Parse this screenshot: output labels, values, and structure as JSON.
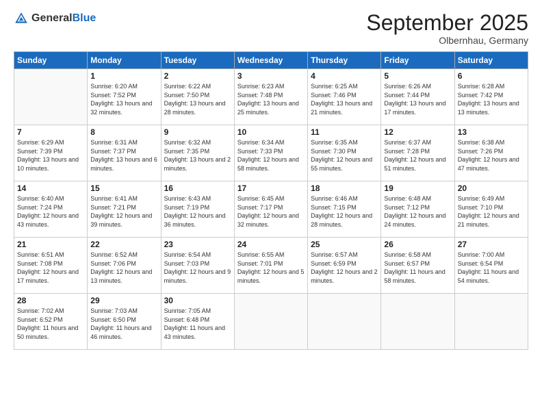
{
  "header": {
    "logo_general": "General",
    "logo_blue": "Blue",
    "month_title": "September 2025",
    "subtitle": "Olbernhau, Germany"
  },
  "weekdays": [
    "Sunday",
    "Monday",
    "Tuesday",
    "Wednesday",
    "Thursday",
    "Friday",
    "Saturday"
  ],
  "weeks": [
    [
      {
        "day": "",
        "sunrise": "",
        "sunset": "",
        "daylight": ""
      },
      {
        "day": "1",
        "sunrise": "Sunrise: 6:20 AM",
        "sunset": "Sunset: 7:52 PM",
        "daylight": "Daylight: 13 hours and 32 minutes."
      },
      {
        "day": "2",
        "sunrise": "Sunrise: 6:22 AM",
        "sunset": "Sunset: 7:50 PM",
        "daylight": "Daylight: 13 hours and 28 minutes."
      },
      {
        "day": "3",
        "sunrise": "Sunrise: 6:23 AM",
        "sunset": "Sunset: 7:48 PM",
        "daylight": "Daylight: 13 hours and 25 minutes."
      },
      {
        "day": "4",
        "sunrise": "Sunrise: 6:25 AM",
        "sunset": "Sunset: 7:46 PM",
        "daylight": "Daylight: 13 hours and 21 minutes."
      },
      {
        "day": "5",
        "sunrise": "Sunrise: 6:26 AM",
        "sunset": "Sunset: 7:44 PM",
        "daylight": "Daylight: 13 hours and 17 minutes."
      },
      {
        "day": "6",
        "sunrise": "Sunrise: 6:28 AM",
        "sunset": "Sunset: 7:42 PM",
        "daylight": "Daylight: 13 hours and 13 minutes."
      }
    ],
    [
      {
        "day": "7",
        "sunrise": "Sunrise: 6:29 AM",
        "sunset": "Sunset: 7:39 PM",
        "daylight": "Daylight: 13 hours and 10 minutes."
      },
      {
        "day": "8",
        "sunrise": "Sunrise: 6:31 AM",
        "sunset": "Sunset: 7:37 PM",
        "daylight": "Daylight: 13 hours and 6 minutes."
      },
      {
        "day": "9",
        "sunrise": "Sunrise: 6:32 AM",
        "sunset": "Sunset: 7:35 PM",
        "daylight": "Daylight: 13 hours and 2 minutes."
      },
      {
        "day": "10",
        "sunrise": "Sunrise: 6:34 AM",
        "sunset": "Sunset: 7:33 PM",
        "daylight": "Daylight: 12 hours and 58 minutes."
      },
      {
        "day": "11",
        "sunrise": "Sunrise: 6:35 AM",
        "sunset": "Sunset: 7:30 PM",
        "daylight": "Daylight: 12 hours and 55 minutes."
      },
      {
        "day": "12",
        "sunrise": "Sunrise: 6:37 AM",
        "sunset": "Sunset: 7:28 PM",
        "daylight": "Daylight: 12 hours and 51 minutes."
      },
      {
        "day": "13",
        "sunrise": "Sunrise: 6:38 AM",
        "sunset": "Sunset: 7:26 PM",
        "daylight": "Daylight: 12 hours and 47 minutes."
      }
    ],
    [
      {
        "day": "14",
        "sunrise": "Sunrise: 6:40 AM",
        "sunset": "Sunset: 7:24 PM",
        "daylight": "Daylight: 12 hours and 43 minutes."
      },
      {
        "day": "15",
        "sunrise": "Sunrise: 6:41 AM",
        "sunset": "Sunset: 7:21 PM",
        "daylight": "Daylight: 12 hours and 39 minutes."
      },
      {
        "day": "16",
        "sunrise": "Sunrise: 6:43 AM",
        "sunset": "Sunset: 7:19 PM",
        "daylight": "Daylight: 12 hours and 36 minutes."
      },
      {
        "day": "17",
        "sunrise": "Sunrise: 6:45 AM",
        "sunset": "Sunset: 7:17 PM",
        "daylight": "Daylight: 12 hours and 32 minutes."
      },
      {
        "day": "18",
        "sunrise": "Sunrise: 6:46 AM",
        "sunset": "Sunset: 7:15 PM",
        "daylight": "Daylight: 12 hours and 28 minutes."
      },
      {
        "day": "19",
        "sunrise": "Sunrise: 6:48 AM",
        "sunset": "Sunset: 7:12 PM",
        "daylight": "Daylight: 12 hours and 24 minutes."
      },
      {
        "day": "20",
        "sunrise": "Sunrise: 6:49 AM",
        "sunset": "Sunset: 7:10 PM",
        "daylight": "Daylight: 12 hours and 21 minutes."
      }
    ],
    [
      {
        "day": "21",
        "sunrise": "Sunrise: 6:51 AM",
        "sunset": "Sunset: 7:08 PM",
        "daylight": "Daylight: 12 hours and 17 minutes."
      },
      {
        "day": "22",
        "sunrise": "Sunrise: 6:52 AM",
        "sunset": "Sunset: 7:06 PM",
        "daylight": "Daylight: 12 hours and 13 minutes."
      },
      {
        "day": "23",
        "sunrise": "Sunrise: 6:54 AM",
        "sunset": "Sunset: 7:03 PM",
        "daylight": "Daylight: 12 hours and 9 minutes."
      },
      {
        "day": "24",
        "sunrise": "Sunrise: 6:55 AM",
        "sunset": "Sunset: 7:01 PM",
        "daylight": "Daylight: 12 hours and 5 minutes."
      },
      {
        "day": "25",
        "sunrise": "Sunrise: 6:57 AM",
        "sunset": "Sunset: 6:59 PM",
        "daylight": "Daylight: 12 hours and 2 minutes."
      },
      {
        "day": "26",
        "sunrise": "Sunrise: 6:58 AM",
        "sunset": "Sunset: 6:57 PM",
        "daylight": "Daylight: 11 hours and 58 minutes."
      },
      {
        "day": "27",
        "sunrise": "Sunrise: 7:00 AM",
        "sunset": "Sunset: 6:54 PM",
        "daylight": "Daylight: 11 hours and 54 minutes."
      }
    ],
    [
      {
        "day": "28",
        "sunrise": "Sunrise: 7:02 AM",
        "sunset": "Sunset: 6:52 PM",
        "daylight": "Daylight: 11 hours and 50 minutes."
      },
      {
        "day": "29",
        "sunrise": "Sunrise: 7:03 AM",
        "sunset": "Sunset: 6:50 PM",
        "daylight": "Daylight: 11 hours and 46 minutes."
      },
      {
        "day": "30",
        "sunrise": "Sunrise: 7:05 AM",
        "sunset": "Sunset: 6:48 PM",
        "daylight": "Daylight: 11 hours and 43 minutes."
      },
      {
        "day": "",
        "sunrise": "",
        "sunset": "",
        "daylight": ""
      },
      {
        "day": "",
        "sunrise": "",
        "sunset": "",
        "daylight": ""
      },
      {
        "day": "",
        "sunrise": "",
        "sunset": "",
        "daylight": ""
      },
      {
        "day": "",
        "sunrise": "",
        "sunset": "",
        "daylight": ""
      }
    ]
  ]
}
